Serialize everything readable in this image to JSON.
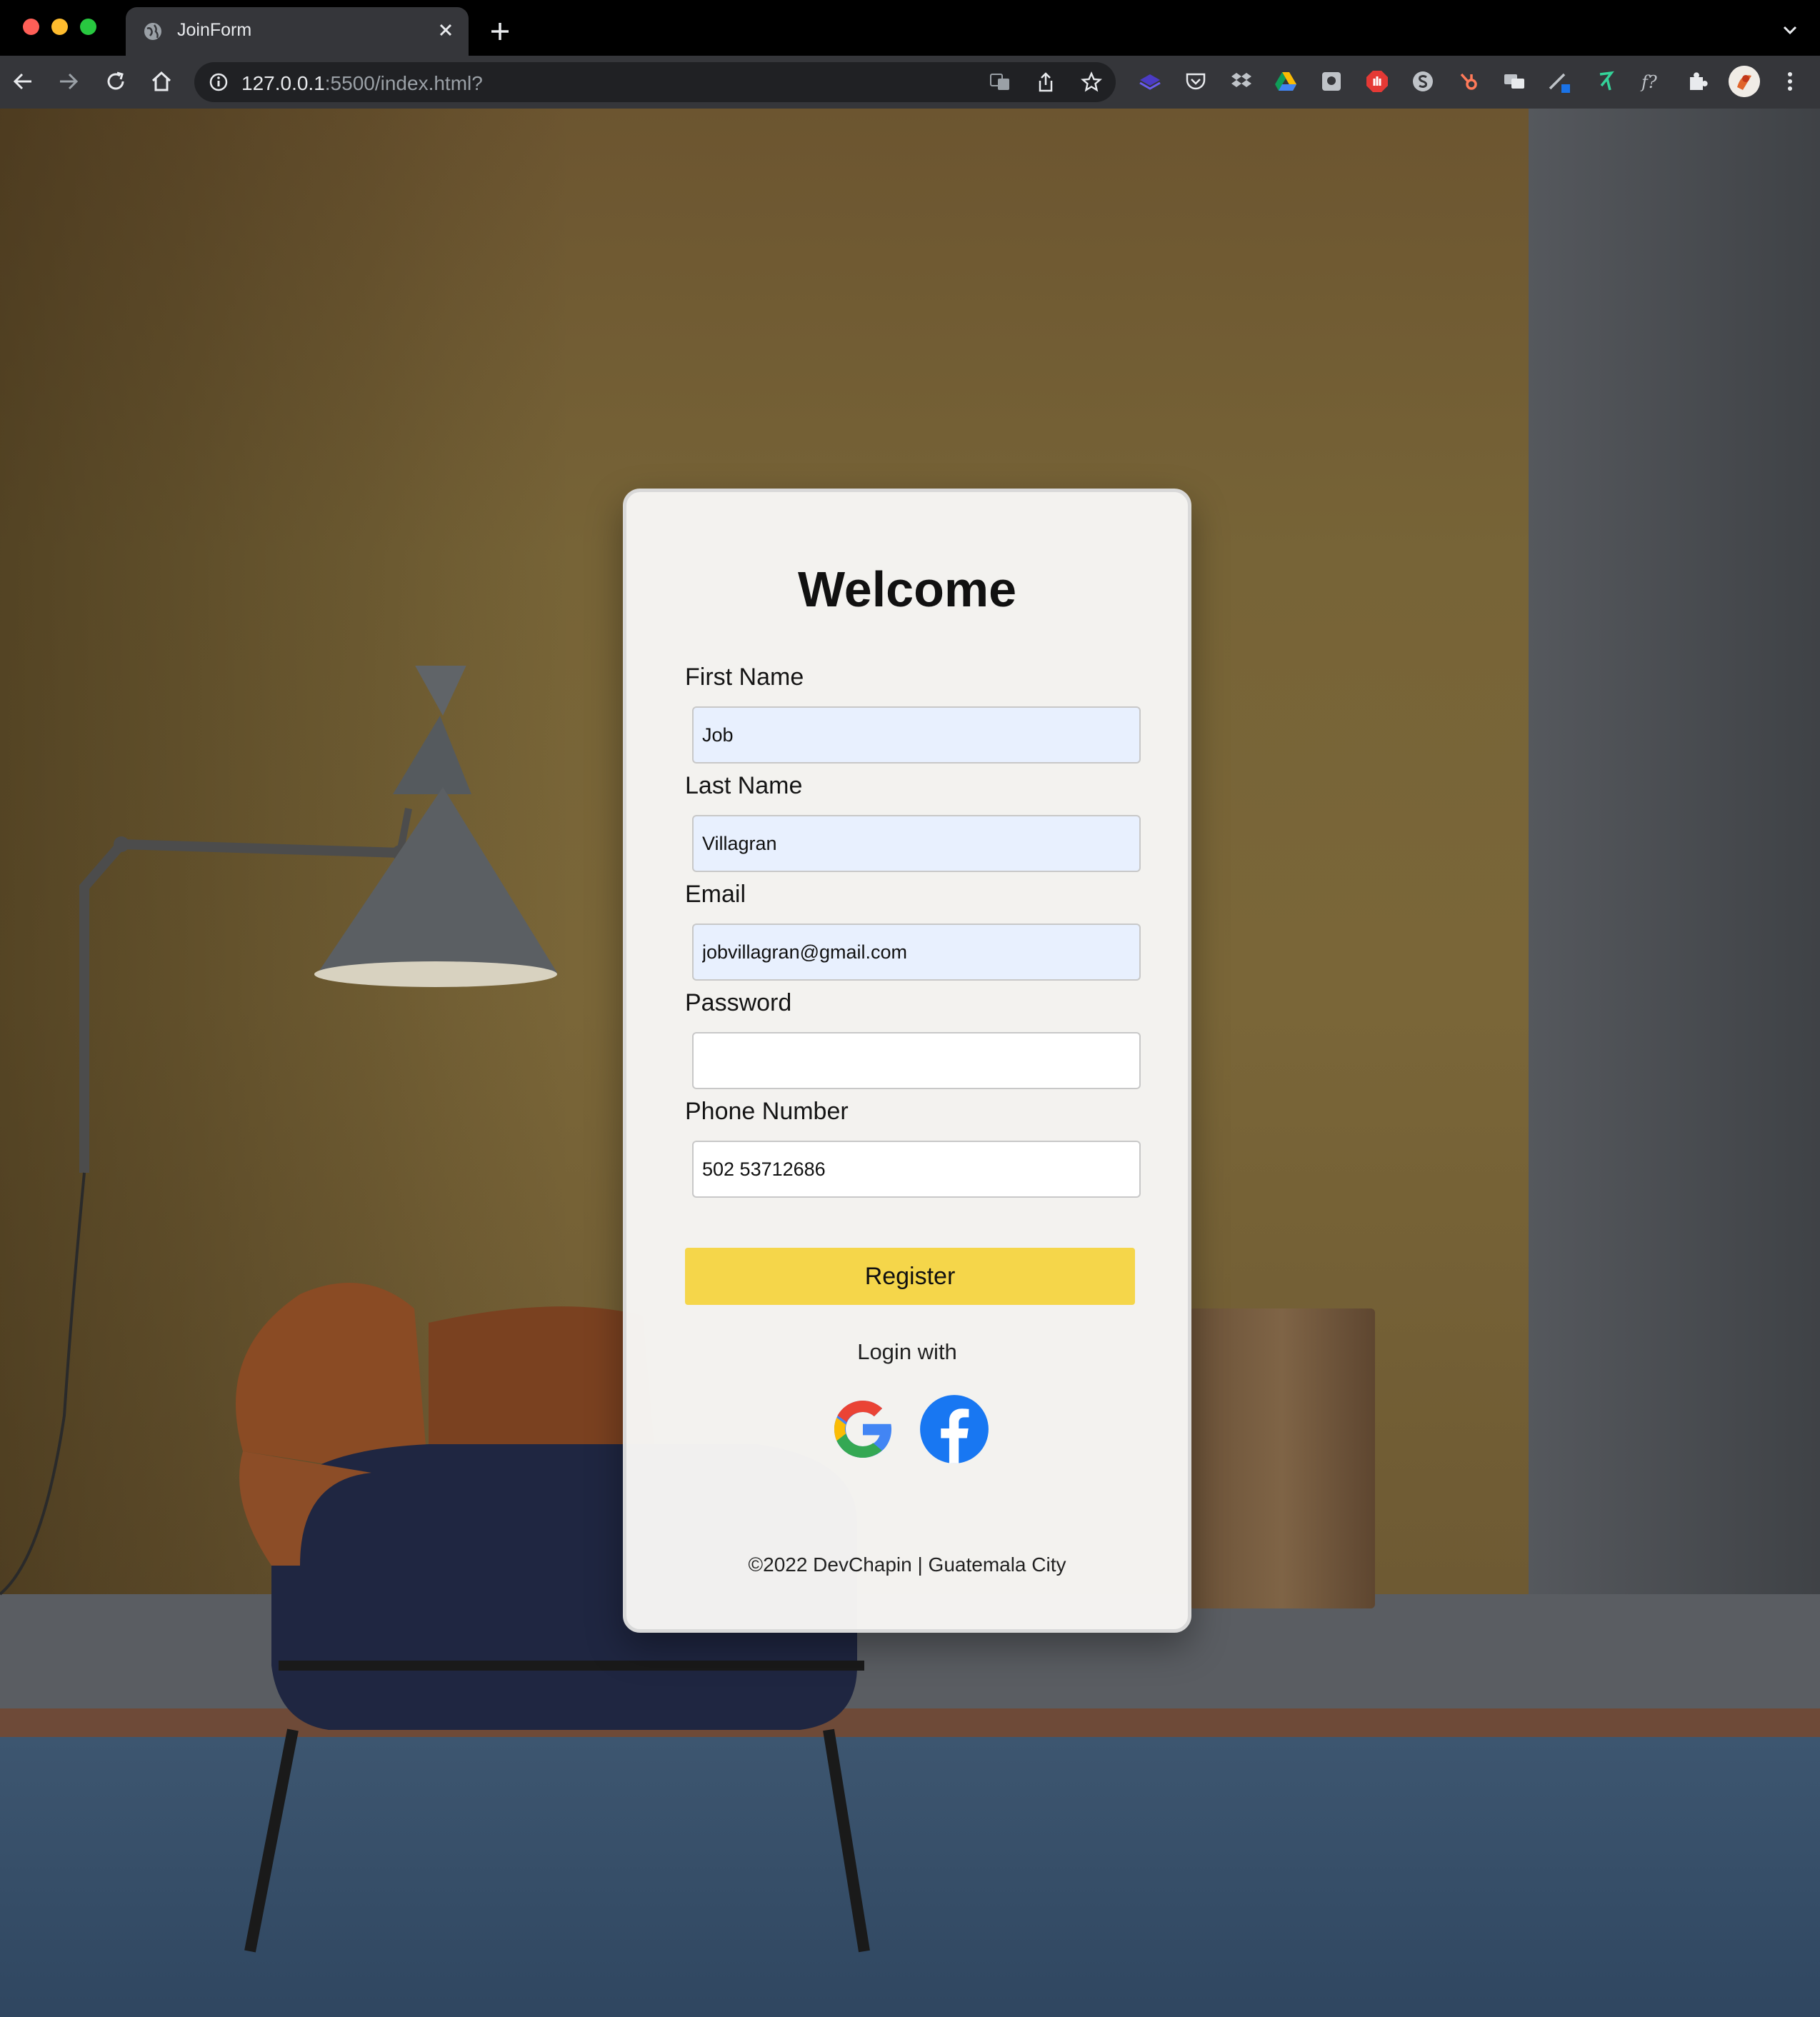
{
  "browser": {
    "tab_title": "JoinForm",
    "url_host": "127.0.0.1",
    "url_rest": ":5500/index.html?"
  },
  "form": {
    "title": "Welcome",
    "fields": [
      {
        "label": "First Name",
        "value": "Job"
      },
      {
        "label": "Last Name",
        "value": "Villagran"
      },
      {
        "label": "Email",
        "value": "jobvillagran@gmail.com"
      },
      {
        "label": "Password",
        "value": ""
      },
      {
        "label": "Phone Number",
        "value": "502 53712686"
      }
    ],
    "register_label": "Register",
    "login_with": "Login with",
    "social": [
      "google-icon",
      "facebook-icon"
    ],
    "footer": "©2022 DevChapin | Guatemala City"
  },
  "colors": {
    "register_button": "#f5d64a",
    "autofill_bg": "#e8f0fe",
    "facebook": "#1877f2"
  }
}
